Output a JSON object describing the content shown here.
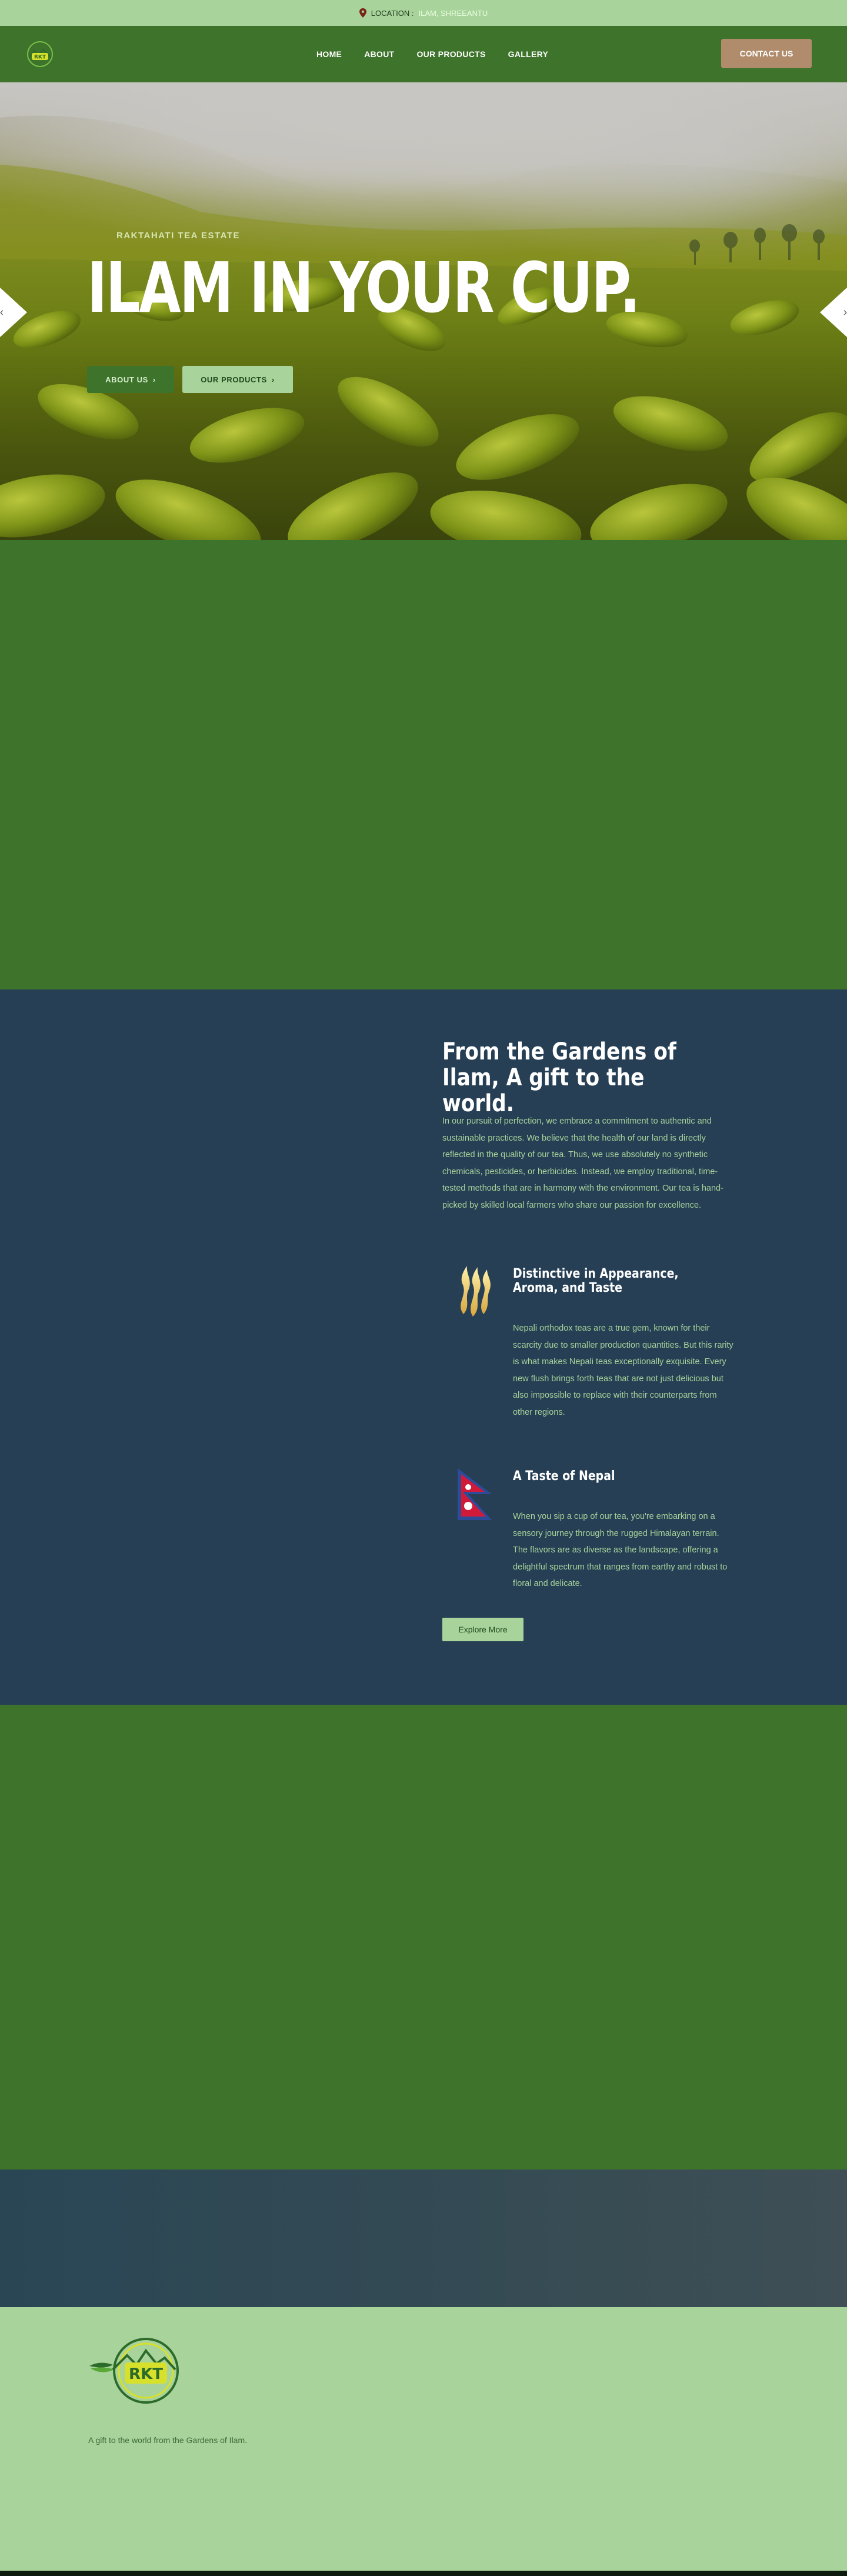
{
  "topbar": {
    "location_label": "LOCATION :",
    "location_value": "ILAM, SHREEANTU"
  },
  "nav": {
    "logo_text": "RKT",
    "links": [
      "HOME",
      "ABOUT",
      "OUR PRODUCTS",
      "GALLERY"
    ],
    "contact_label": "CONTACT US"
  },
  "hero": {
    "subtitle": "RAKTAHATI TEA ESTATE",
    "title": "ILAM IN YOUR CUP.",
    "about_label": "ABOUT US",
    "products_label": "OUR PRODUCTS"
  },
  "story": {
    "title": "From the Gardens of Ilam, A gift to the world.",
    "body": "In our pursuit of perfection, we embrace a commitment to authentic and sustainable practices. We believe that the health of our land is directly reflected in the quality of our tea. Thus, we use absolutely no synthetic chemicals, pesticides, or herbicides. Instead, we employ traditional, time-tested methods that are in harmony with the environment. Our tea is hand-picked by skilled local farmers who share our passion for excellence.",
    "features": [
      {
        "title": "Distinctive in Appearance, Aroma, and Taste",
        "body": "Nepali orthodox teas are a true gem, known for their scarcity due to smaller production quantities. But this rarity is what makes Nepali teas exceptionally exquisite. Every new flush brings forth teas that are not just delicious but also impossible to replace with their counterparts from other regions.",
        "icon": "aroma-flame-icon"
      },
      {
        "title": "A Taste of Nepal",
        "body": "When you sip a cup of our tea, you're embarking on a sensory journey through the rugged Himalayan terrain. The flavors are as diverse as the landscape, offering a delightful spectrum that ranges from earthy and robust to floral and delicate.",
        "icon": "nepal-flag-icon"
      }
    ],
    "explore_label": "Explore More"
  },
  "footer": {
    "logo_text": "RKT",
    "tagline": "A gift to the world from the Gardens of Ilam."
  },
  "colors": {
    "brand_green": "#3d732b",
    "light_green": "#a8d39a",
    "navy": "#263f55",
    "tan": "#b18c6c"
  }
}
